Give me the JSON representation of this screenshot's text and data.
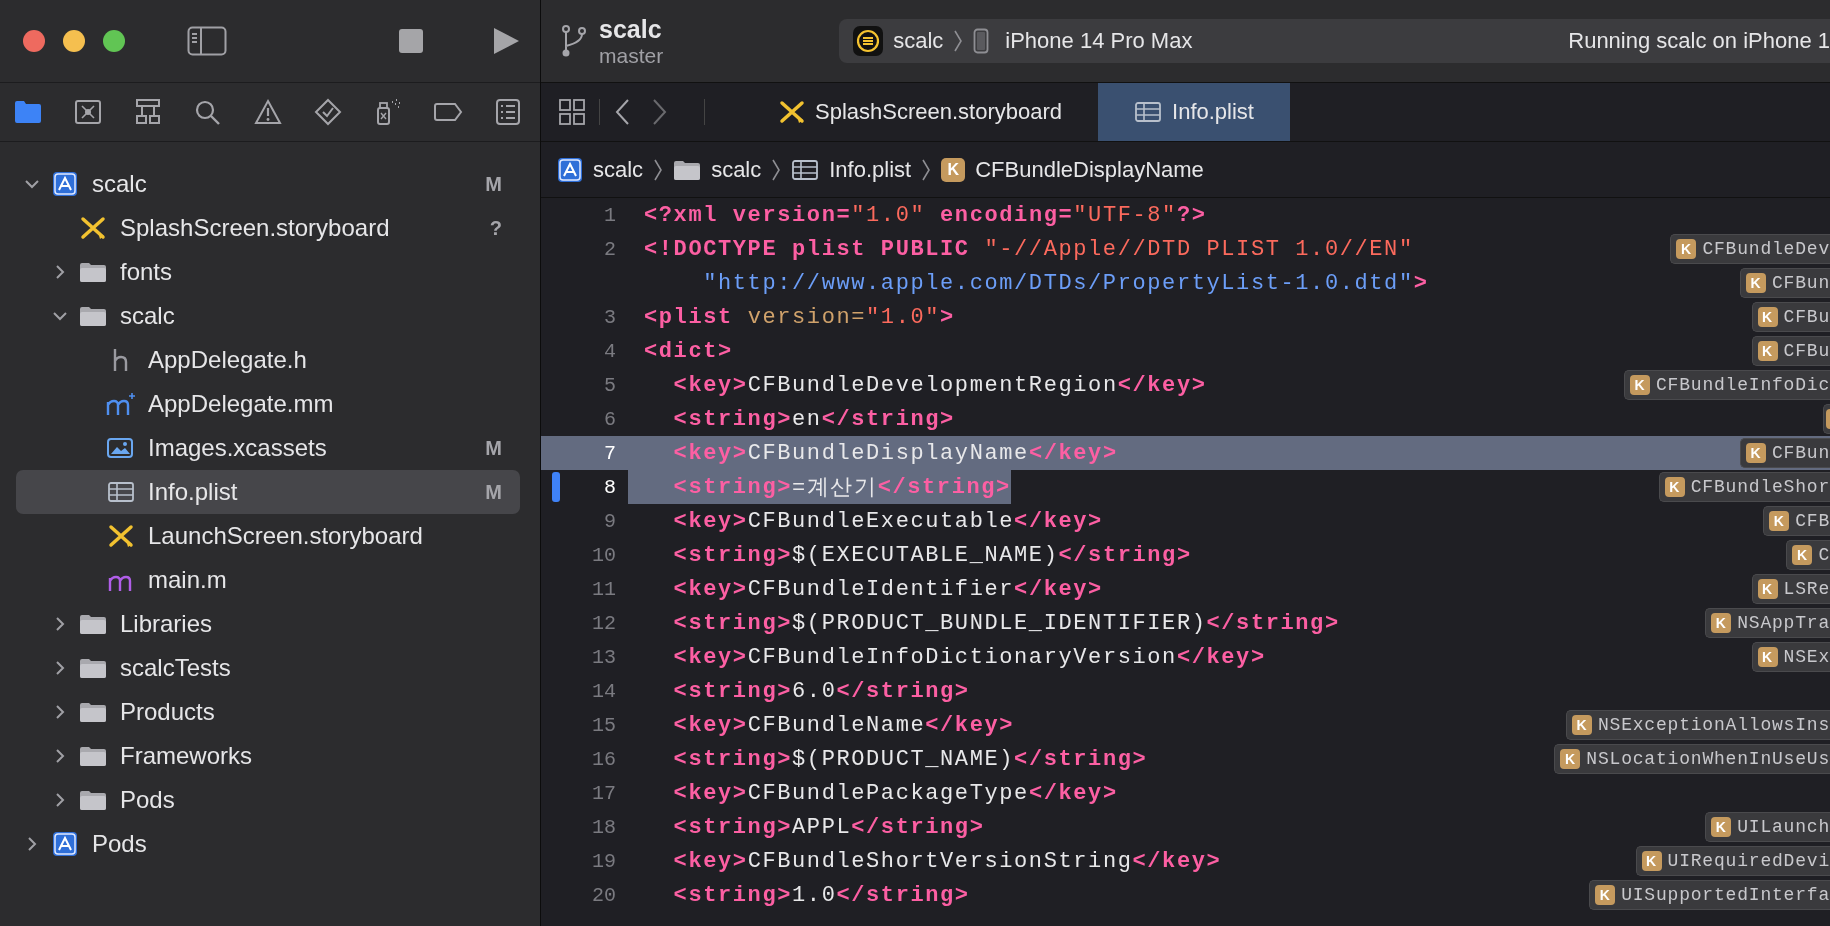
{
  "toolbar": {
    "project": "scalc",
    "branch": "master",
    "scheme": "scalc",
    "device": "iPhone 14 Pro Max",
    "status": "Running scalc on iPhone 1"
  },
  "navigator_tabs": [
    {
      "kind": "folder",
      "selected": true
    },
    {
      "kind": "square-x",
      "selected": false
    },
    {
      "kind": "hierarchy",
      "selected": false
    },
    {
      "kind": "search",
      "selected": false
    },
    {
      "kind": "warning",
      "selected": false
    },
    {
      "kind": "diamond-check",
      "selected": false
    },
    {
      "kind": "spray",
      "selected": false
    },
    {
      "kind": "tag",
      "selected": false
    },
    {
      "kind": "list",
      "selected": false
    }
  ],
  "tree": [
    {
      "name": "scalc",
      "kind": "project",
      "badge": "M",
      "expanded": true,
      "selected": false,
      "children": [
        {
          "name": "SplashScreen.storyboard",
          "kind": "storyboard",
          "badge": "?",
          "selected": false
        },
        {
          "name": "fonts",
          "kind": "folder",
          "expanded": false,
          "selected": false
        },
        {
          "name": "scalc",
          "kind": "folder",
          "expanded": true,
          "selected": false,
          "children": [
            {
              "name": "AppDelegate.h",
              "kind": "header",
              "selected": false
            },
            {
              "name": "AppDelegate.mm",
              "kind": "objc-plus",
              "selected": false
            },
            {
              "name": "Images.xcassets",
              "kind": "assets",
              "badge": "M",
              "selected": false
            },
            {
              "name": "Info.plist",
              "kind": "plist",
              "badge": "M",
              "selected": true
            },
            {
              "name": "LaunchScreen.storyboard",
              "kind": "storyboard",
              "selected": false
            },
            {
              "name": "main.m",
              "kind": "objc",
              "selected": false
            }
          ]
        },
        {
          "name": "Libraries",
          "kind": "folder",
          "expanded": false,
          "selected": false
        },
        {
          "name": "scalcTests",
          "kind": "folder",
          "expanded": false,
          "selected": false
        },
        {
          "name": "Products",
          "kind": "folder",
          "expanded": false,
          "selected": false
        },
        {
          "name": "Frameworks",
          "kind": "folder",
          "expanded": false,
          "selected": false
        },
        {
          "name": "Pods",
          "kind": "folder",
          "expanded": false,
          "selected": false
        }
      ]
    },
    {
      "name": "Pods",
      "kind": "project",
      "expanded": false,
      "selected": false
    }
  ],
  "tabs": [
    {
      "label": "SplashScreen.storyboard",
      "kind": "storyboard",
      "selected": false
    },
    {
      "label": "Info.plist",
      "kind": "plist",
      "selected": true
    }
  ],
  "breadcrumb": [
    {
      "label": "scalc",
      "kind": "project"
    },
    {
      "label": "scalc",
      "kind": "folder"
    },
    {
      "label": "Info.plist",
      "kind": "plist"
    },
    {
      "label": "CFBundleDisplayName",
      "kind": "key",
      "badge": "K"
    }
  ],
  "code": [
    {
      "number": "1",
      "selected": false,
      "changed": false,
      "segments": [
        {
          "kind": "tag",
          "text": "<?xml"
        },
        {
          "kind": "attr",
          "text": " version="
        },
        {
          "kind": "string",
          "text": "\"1.0\""
        },
        {
          "kind": "attr",
          "text": " encoding="
        },
        {
          "kind": "string",
          "text": "\"UTF-8\""
        },
        {
          "kind": "tag",
          "text": "?>"
        }
      ]
    },
    {
      "number": "2",
      "selected": false,
      "changed": false,
      "segments": [
        {
          "kind": "tag",
          "text": "<!DOCTYPE plist PUBLIC "
        },
        {
          "kind": "string",
          "text": "\"-//Apple//DTD PLIST 1.0//EN\""
        }
      ],
      "outline": {
        "kind": "key",
        "badge": "K",
        "label": "CFBundleDev"
      }
    },
    {
      "selected": false,
      "changed": false,
      "segments": [
        {
          "kind": "url",
          "text": "    \"http://www.apple.com/DTDs/PropertyList-1.0.dtd\""
        },
        {
          "kind": "tag",
          "text": ">"
        }
      ],
      "outline": {
        "kind": "key",
        "badge": "K",
        "label": "CFBun"
      }
    },
    {
      "number": "3",
      "selected": false,
      "changed": false,
      "segments": [
        {
          "kind": "tag",
          "text": "<plist"
        },
        {
          "kind": "param",
          "text": " version="
        },
        {
          "kind": "string",
          "text": "\"1.0\""
        },
        {
          "kind": "tag",
          "text": ">"
        }
      ],
      "outline": {
        "kind": "key",
        "badge": "K",
        "label": "CFBu"
      }
    },
    {
      "number": "4",
      "selected": false,
      "changed": false,
      "segments": [
        {
          "kind": "tag",
          "text": "<dict>"
        }
      ],
      "outline": {
        "kind": "key",
        "badge": "K",
        "label": "CFBu"
      }
    },
    {
      "number": "5",
      "selected": false,
      "changed": false,
      "segments": [
        {
          "kind": "tag",
          "text": "  <key>"
        },
        {
          "kind": "text",
          "text": "CFBundleDevelopmentRegion"
        },
        {
          "kind": "tag",
          "text": "</key>"
        }
      ],
      "outline": {
        "kind": "key",
        "badge": "K",
        "label": "CFBundleInfoDic"
      }
    },
    {
      "number": "6",
      "selected": false,
      "changed": false,
      "segments": [
        {
          "kind": "tag",
          "text": "  <string>"
        },
        {
          "kind": "text",
          "text": "en"
        },
        {
          "kind": "tag",
          "text": "</string>"
        }
      ],
      "outline": {
        "kind": "badge"
      }
    },
    {
      "number": "7",
      "selected": true,
      "changed": false,
      "segments": [
        {
          "kind": "tag",
          "text": "  <key>"
        },
        {
          "kind": "text",
          "text": "CFBundleDisplayName"
        },
        {
          "kind": "tag",
          "text": "</key>"
        }
      ],
      "outline": {
        "kind": "key",
        "badge": "K",
        "label": "CFBun"
      }
    },
    {
      "number": "8",
      "selected": true,
      "changed": true,
      "segments": [
        {
          "kind": "tag",
          "text": "  <string>"
        },
        {
          "kind": "text",
          "text": "=계산기"
        },
        {
          "kind": "tag",
          "text": "</string>"
        }
      ],
      "outline": {
        "kind": "key",
        "badge": "K",
        "label": "CFBundleShor"
      }
    },
    {
      "number": "9",
      "selected": false,
      "changed": false,
      "segments": [
        {
          "kind": "tag",
          "text": "  <key>"
        },
        {
          "kind": "text",
          "text": "CFBundleExecutable"
        },
        {
          "kind": "tag",
          "text": "</key>"
        }
      ],
      "outline": {
        "kind": "key",
        "badge": "K",
        "label": "CFB"
      }
    },
    {
      "number": "10",
      "selected": false,
      "changed": false,
      "segments": [
        {
          "kind": "tag",
          "text": "  <string>"
        },
        {
          "kind": "text",
          "text": "$(EXECUTABLE_NAME)"
        },
        {
          "kind": "tag",
          "text": "</string>"
        }
      ],
      "outline": {
        "kind": "key",
        "badge": "K",
        "label": "C"
      }
    },
    {
      "number": "11",
      "selected": false,
      "changed": false,
      "segments": [
        {
          "kind": "tag",
          "text": "  <key>"
        },
        {
          "kind": "text",
          "text": "CFBundleIdentifier"
        },
        {
          "kind": "tag",
          "text": "</key>"
        }
      ],
      "outline": {
        "kind": "key",
        "badge": "K",
        "label": "LSRe"
      }
    },
    {
      "number": "12",
      "selected": false,
      "changed": false,
      "segments": [
        {
          "kind": "tag",
          "text": "  <string>"
        },
        {
          "kind": "text",
          "text": "$(PRODUCT_BUNDLE_IDENTIFIER)"
        },
        {
          "kind": "tag",
          "text": "</string>"
        }
      ],
      "outline": {
        "kind": "key",
        "badge": "K",
        "label": "NSAppTra"
      }
    },
    {
      "number": "13",
      "selected": false,
      "changed": false,
      "segments": [
        {
          "kind": "tag",
          "text": "  <key>"
        },
        {
          "kind": "text",
          "text": "CFBundleInfoDictionaryVersion"
        },
        {
          "kind": "tag",
          "text": "</key>"
        }
      ],
      "outline": {
        "kind": "key",
        "badge": "K",
        "label": "NSEx"
      }
    },
    {
      "number": "14",
      "selected": false,
      "changed": false,
      "segments": [
        {
          "kind": "tag",
          "text": "  <string>"
        },
        {
          "kind": "text",
          "text": "6.0"
        },
        {
          "kind": "tag",
          "text": "</string>"
        }
      ]
    },
    {
      "number": "15",
      "selected": false,
      "changed": false,
      "segments": [
        {
          "kind": "tag",
          "text": "  <key>"
        },
        {
          "kind": "text",
          "text": "CFBundleName"
        },
        {
          "kind": "tag",
          "text": "</key>"
        }
      ],
      "outline": {
        "kind": "key",
        "badge": "K",
        "label": "NSExceptionAllowsIns"
      }
    },
    {
      "number": "16",
      "selected": false,
      "changed": false,
      "segments": [
        {
          "kind": "tag",
          "text": "  <string>"
        },
        {
          "kind": "text",
          "text": "$(PRODUCT_NAME)"
        },
        {
          "kind": "tag",
          "text": "</string>"
        }
      ],
      "outline": {
        "kind": "key",
        "badge": "K",
        "label": "NSLocationWhenInUseUs"
      }
    },
    {
      "number": "17",
      "selected": false,
      "changed": false,
      "segments": [
        {
          "kind": "tag",
          "text": "  <key>"
        },
        {
          "kind": "text",
          "text": "CFBundlePackageType"
        },
        {
          "kind": "tag",
          "text": "</key>"
        }
      ]
    },
    {
      "number": "18",
      "selected": false,
      "changed": false,
      "segments": [
        {
          "kind": "tag",
          "text": "  <string>"
        },
        {
          "kind": "text",
          "text": "APPL"
        },
        {
          "kind": "tag",
          "text": "</string>"
        }
      ],
      "outline": {
        "kind": "key",
        "badge": "K",
        "label": "UILaunch"
      }
    },
    {
      "number": "19",
      "selected": false,
      "changed": false,
      "segments": [
        {
          "kind": "tag",
          "text": "  <key>"
        },
        {
          "kind": "text",
          "text": "CFBundleShortVersionString"
        },
        {
          "kind": "tag",
          "text": "</key>"
        }
      ],
      "outline": {
        "kind": "key",
        "badge": "K",
        "label": "UIRequiredDevi"
      }
    },
    {
      "number": "20",
      "selected": false,
      "changed": false,
      "segments": [
        {
          "kind": "tag",
          "text": "  <string>"
        },
        {
          "kind": "text",
          "text": "1.0"
        },
        {
          "kind": "tag",
          "text": "</string>"
        }
      ],
      "outline": {
        "kind": "key",
        "badge": "K",
        "label": "UISupportedInterfa"
      }
    }
  ]
}
